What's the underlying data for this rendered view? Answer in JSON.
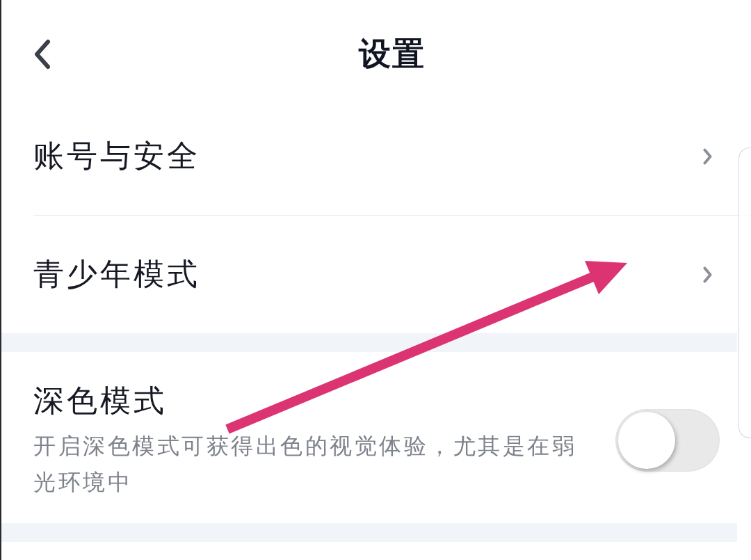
{
  "header": {
    "title": "设置"
  },
  "sections": [
    {
      "items": [
        {
          "kind": "link",
          "label": "账号与安全"
        },
        {
          "kind": "link",
          "label": "青少年模式"
        }
      ]
    },
    {
      "items": [
        {
          "kind": "toggle",
          "label": "深色模式",
          "description": "开启深色模式可获得出色的视觉体验，尤其是在弱光环境中",
          "on": false
        }
      ]
    }
  ]
}
